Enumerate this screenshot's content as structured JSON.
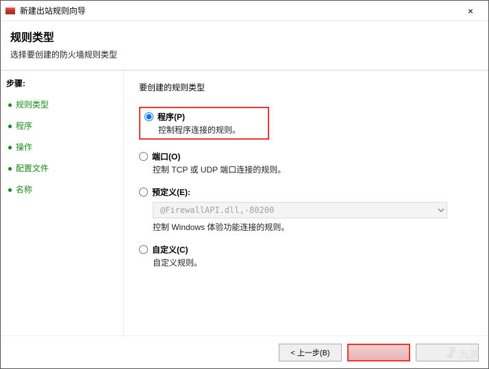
{
  "window": {
    "title": "新建出站规则向导",
    "close_label": "×"
  },
  "header": {
    "title": "规则类型",
    "subtitle": "选择要创建的防火墙规则类型"
  },
  "sidebar": {
    "steps_label": "步骤:",
    "bullet": "●",
    "items": [
      {
        "label": "规则类型"
      },
      {
        "label": "程序"
      },
      {
        "label": "操作"
      },
      {
        "label": "配置文件"
      },
      {
        "label": "名称"
      }
    ]
  },
  "content": {
    "heading": "要创建的规则类型",
    "options": [
      {
        "label": "程序(P)",
        "desc": "控制程序连接的规则。",
        "checked": true
      },
      {
        "label": "端口(O)",
        "desc": "控制 TCP 或 UDP 端口连接的规则。",
        "checked": false
      },
      {
        "label": "预定义(E):",
        "desc": "控制 Windows 体验功能连接的规则。",
        "checked": false,
        "combo": "@FirewallAPI.dll,-80200"
      },
      {
        "label": "自定义(C)",
        "desc": "自定义规则。",
        "checked": false
      }
    ]
  },
  "footer": {
    "back": "< 上一步(B)",
    "next": " ",
    "cancel": " "
  },
  "watermark": {
    "text": "九游"
  }
}
